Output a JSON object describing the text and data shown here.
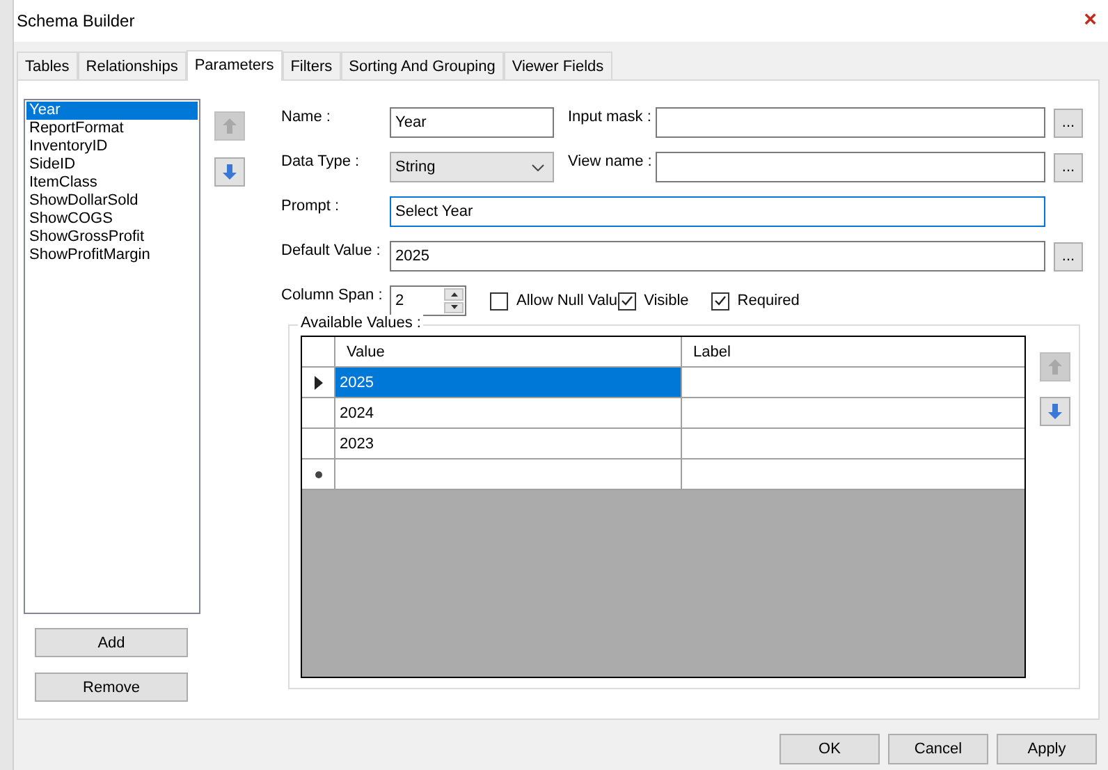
{
  "window": {
    "title": "Schema Builder",
    "close": "×"
  },
  "tabs": [
    {
      "label": "Tables",
      "selected": false
    },
    {
      "label": "Relationships",
      "selected": false
    },
    {
      "label": "Parameters",
      "selected": true
    },
    {
      "label": "Filters",
      "selected": false
    },
    {
      "label": "Sorting And Grouping",
      "selected": false
    },
    {
      "label": "Viewer Fields",
      "selected": false
    }
  ],
  "parameters": [
    {
      "label": "Year",
      "selected": true
    },
    {
      "label": "ReportFormat",
      "selected": false
    },
    {
      "label": "InventoryID",
      "selected": false
    },
    {
      "label": "SideID",
      "selected": false
    },
    {
      "label": "ItemClass",
      "selected": false
    },
    {
      "label": "ShowDollarSold",
      "selected": false
    },
    {
      "label": "ShowCOGS",
      "selected": false
    },
    {
      "label": "ShowGrossProfit",
      "selected": false
    },
    {
      "label": "ShowProfitMargin",
      "selected": false
    }
  ],
  "parameter_move_buttons": [
    {
      "kind": "up",
      "disabled": true
    },
    {
      "kind": "down",
      "disabled": false
    }
  ],
  "add_button": "Add",
  "remove_button": "Remove",
  "name": {
    "label": "Name :",
    "value": "Year"
  },
  "input_mask": {
    "label": "Input mask :",
    "browse": "..."
  },
  "data_type": {
    "label": "Data Type :",
    "value": "String"
  },
  "view_name": {
    "label": "View name :",
    "browse": "..."
  },
  "prompt": {
    "label": "Prompt :",
    "value": "Select Year",
    "focused": true
  },
  "default_value": {
    "label": "Default Value :",
    "value": "2025",
    "browse": "..."
  },
  "column_span": {
    "label": "Column Span :",
    "value": "2"
  },
  "options": [
    {
      "label": "Allow Null Valu",
      "checked": false
    },
    {
      "label": "Visible",
      "checked": true
    },
    {
      "label": "Required",
      "checked": true
    }
  ],
  "available_values": {
    "title": "Available Values :",
    "columns": [
      "Value",
      "Label"
    ],
    "rows": [
      {
        "value": "2025",
        "selected": true
      },
      {
        "value": "2024",
        "selected": false
      },
      {
        "value": "2023",
        "selected": false
      }
    ],
    "move_buttons": [
      {
        "kind": "up",
        "disabled": true
      },
      {
        "kind": "down",
        "disabled": false
      }
    ]
  },
  "footer_buttons": [
    "OK",
    "Cancel",
    "Apply"
  ]
}
